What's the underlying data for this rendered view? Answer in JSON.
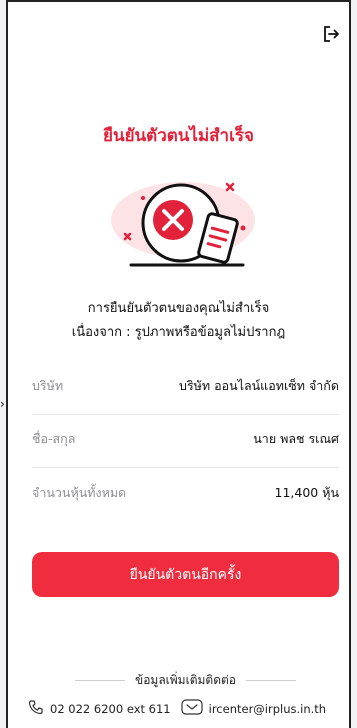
{
  "header": {
    "logout_icon": "logout-icon"
  },
  "result": {
    "title": "ยืนยันตัวตนไม่สำเร็จ",
    "message_line1": "การยืนยันตัวตนของคุณไม่สำเร็จ",
    "message_line2": "เนื่องจาก : รูปภาพหรือข้อมูลไม่ปรากฎ"
  },
  "details": [
    {
      "label": "บริษัท",
      "value": "บริษัท ออนไลน์แอทเซ็ท จำกัด"
    },
    {
      "label": "ชื่อ-สกุล",
      "value": "นาย พลช รเณศ"
    },
    {
      "label": "จำนวนหุ้นทั้งหมด",
      "value": "11,400 หุ้น"
    }
  ],
  "retry_label": "ยืนยันตัวตนอีกครั้ง",
  "footer": {
    "more_info": "ข้อมูลเพิ่มเติมติดต่อ",
    "phone": "02 022 6200 ext 611",
    "email": "ircenter@irplus.in.th"
  },
  "colors": {
    "accent": "#e2213a",
    "button": "#ef2d3f"
  }
}
